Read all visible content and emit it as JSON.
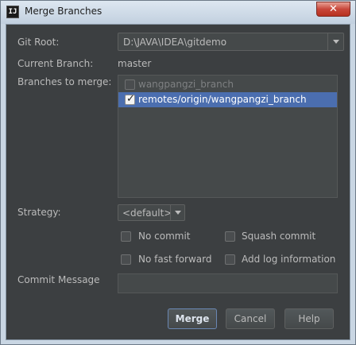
{
  "window": {
    "title": "Merge Branches",
    "close_glyph": "✕",
    "app_icon_text": "IJ"
  },
  "git_root": {
    "label": "Git Root:",
    "value": "D:\\JAVA\\IDEA\\gitdemo"
  },
  "current_branch": {
    "label": "Current Branch:",
    "value": "master"
  },
  "branches": {
    "label": "Branches to merge:",
    "items": [
      {
        "name": "wangpangzi_branch",
        "checked": false,
        "selected": false
      },
      {
        "name": "remotes/origin/wangpangzi_branch",
        "checked": true,
        "selected": true
      }
    ]
  },
  "strategy": {
    "label": "Strategy:",
    "value": "<default>"
  },
  "options": {
    "no_commit": "No commit",
    "squash_commit": "Squash commit",
    "no_fast_forward": "No fast forward",
    "add_log": "Add log information"
  },
  "commit_message": {
    "label": "Commit Message",
    "value": ""
  },
  "buttons": {
    "merge": "Merge",
    "cancel": "Cancel",
    "help": "Help"
  },
  "colors": {
    "background": "#3c3f41",
    "selection": "#4b6eaf",
    "text": "#bbbbbb"
  }
}
